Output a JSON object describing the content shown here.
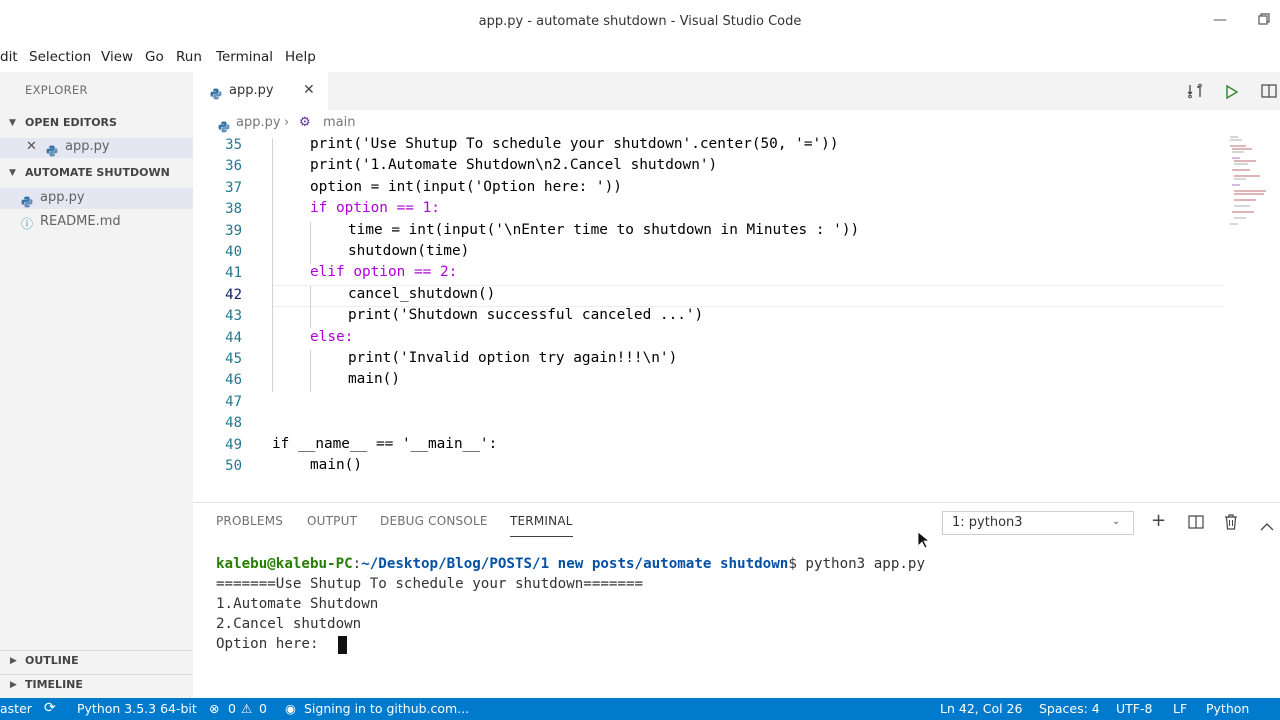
{
  "window": {
    "title": "app.py - automate shutdown - Visual Studio Code",
    "minimize_icon": "minimize-icon",
    "restore_icon": "restore-icon"
  },
  "menu": [
    "dit",
    "Selection",
    "View",
    "Go",
    "Run",
    "Terminal",
    "Help"
  ],
  "sidebar": {
    "title": "EXPLORER",
    "open_editors": {
      "label": "OPEN EDITORS",
      "items": [
        {
          "name": "app.py"
        }
      ]
    },
    "folder": {
      "label": "AUTOMATE SHUTDOWN",
      "files": [
        {
          "name": "app.py"
        },
        {
          "name": "README.md"
        }
      ]
    },
    "outline": "OUTLINE",
    "timeline": "TIMELINE"
  },
  "editor": {
    "tab": {
      "label": "app.py"
    },
    "breadcrumb": {
      "file": "app.py",
      "symbol": "main"
    },
    "line_numbers": [
      "35",
      "36",
      "37",
      "38",
      "39",
      "40",
      "41",
      "42",
      "43",
      "44",
      "45",
      "46",
      "47",
      "48",
      "49",
      "50"
    ],
    "lines": [
      "print('Use Shutup To schedule your shutdown'.center(50, '='))",
      "print('1.Automate Shutdown\\n2.Cancel shutdown')",
      "option = int(input('Option here: '))",
      "if option == 1:",
      "time = int(input('\\nEnter time to shutdown in Minutes : '))",
      "shutdown(time)",
      "elif option == 2:",
      "cancel_shutdown()",
      "print('Shutdown successful canceled ...')",
      "else:",
      "print('Invalid option try again!!!\\n')",
      "main()",
      "",
      "",
      "if __name__ == '__main__':",
      "main()"
    ]
  },
  "panel": {
    "tabs": [
      "PROBLEMS",
      "OUTPUT",
      "DEBUG CONSOLE",
      "TERMINAL"
    ],
    "active_tab": "TERMINAL",
    "terminal_select": "1: python3",
    "terminal": {
      "prompt_user": "kalebu@kalebu-PC",
      "prompt_path": "~/Desktop/Blog/POSTS/1 new posts/automate shutdown",
      "command": "python3 app.py",
      "output": [
        "=======Use Shutup To schedule your shutdown=======",
        "1.Automate Shutdown",
        "2.Cancel shutdown",
        "Option here: "
      ]
    }
  },
  "statusbar": {
    "branch": "aster",
    "interpreter": "Python 3.5.3 64-bit",
    "errors": "0",
    "warnings": "0",
    "github": "Signing in to github.com...",
    "position": "Ln 42, Col 26",
    "spaces": "Spaces: 4",
    "encoding": "UTF-8",
    "eol": "LF",
    "language": "Python"
  },
  "colors": {
    "status_bar": "#007acc",
    "sidebar": "#f3f3f3",
    "selection": "#e4e6f1"
  }
}
